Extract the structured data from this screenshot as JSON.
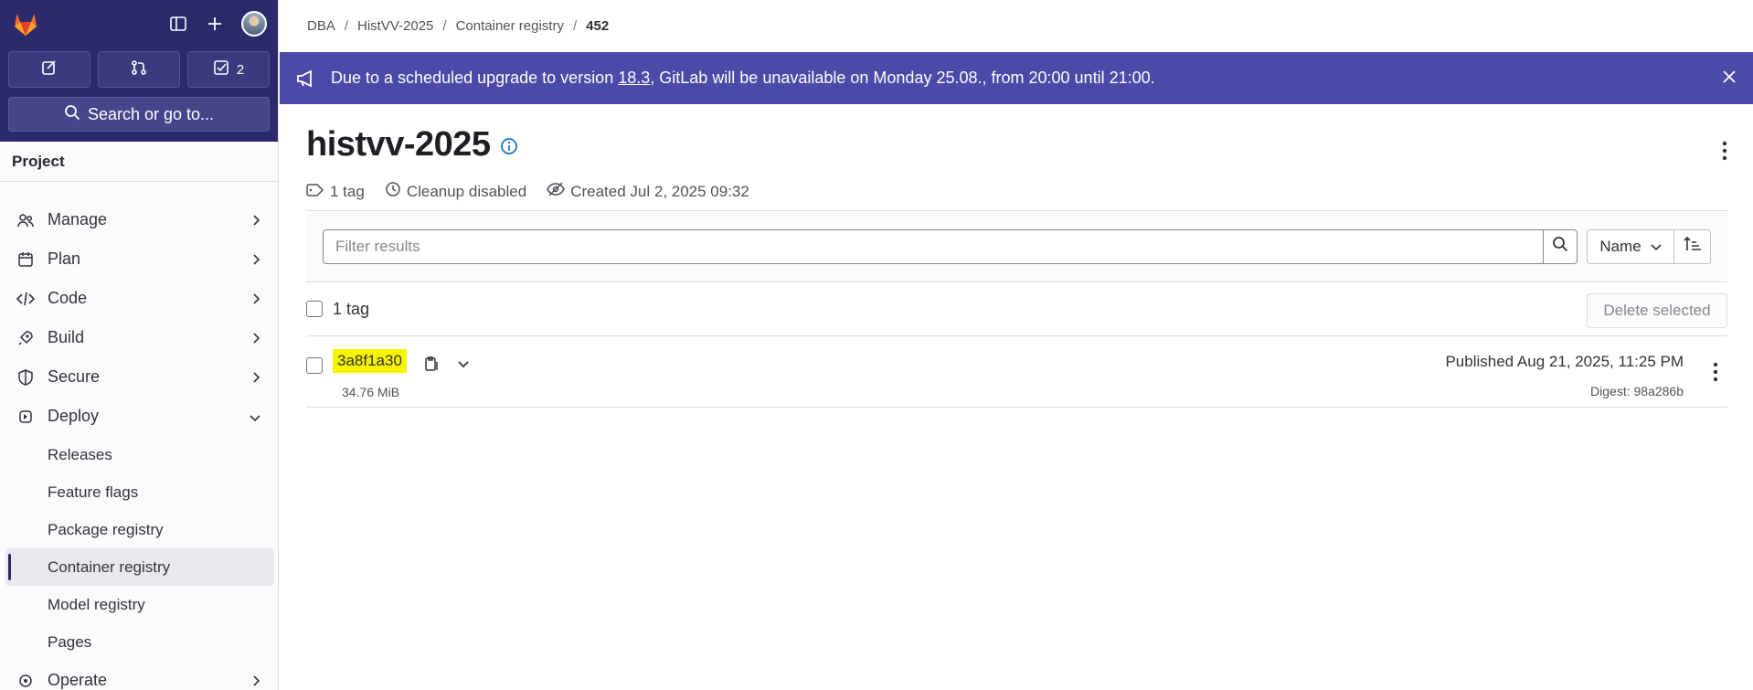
{
  "sidebar": {
    "todo_count": "2",
    "search_label": "Search or go to...",
    "project_label": "Project",
    "items": [
      {
        "label": "Manage"
      },
      {
        "label": "Plan"
      },
      {
        "label": "Code"
      },
      {
        "label": "Build"
      },
      {
        "label": "Secure"
      },
      {
        "label": "Deploy"
      }
    ],
    "deploy_sub": [
      {
        "label": "Releases"
      },
      {
        "label": "Feature flags"
      },
      {
        "label": "Package registry"
      },
      {
        "label": "Container registry"
      },
      {
        "label": "Model registry"
      },
      {
        "label": "Pages"
      }
    ],
    "operate_label": "Operate"
  },
  "breadcrumb": {
    "items": [
      "DBA",
      "HistVV-2025",
      "Container registry"
    ],
    "current": "452"
  },
  "banner": {
    "prefix": "Due to a scheduled upgrade to version ",
    "version": "18.3",
    "suffix": ", GitLab will be unavailable on Monday 25.08., from 20:00 until 21:00."
  },
  "repo": {
    "title": "histvv-2025",
    "tags": "1 tag",
    "cleanup": "Cleanup disabled",
    "created": "Created Jul 2, 2025 09:32"
  },
  "filter": {
    "placeholder": "Filter results",
    "sort_label": "Name"
  },
  "list": {
    "count_label": "1 tag",
    "delete_label": "Delete selected",
    "rows": [
      {
        "name": "3a8f1a30",
        "size": "34.76 MiB",
        "published": "Published Aug 21, 2025, 11:25 PM",
        "digest": "Digest: 98a286b"
      }
    ]
  },
  "colors": {
    "sidebar_top": "#2b2a6b",
    "banner": "#4a4aa8",
    "highlight": "#f5f500"
  }
}
